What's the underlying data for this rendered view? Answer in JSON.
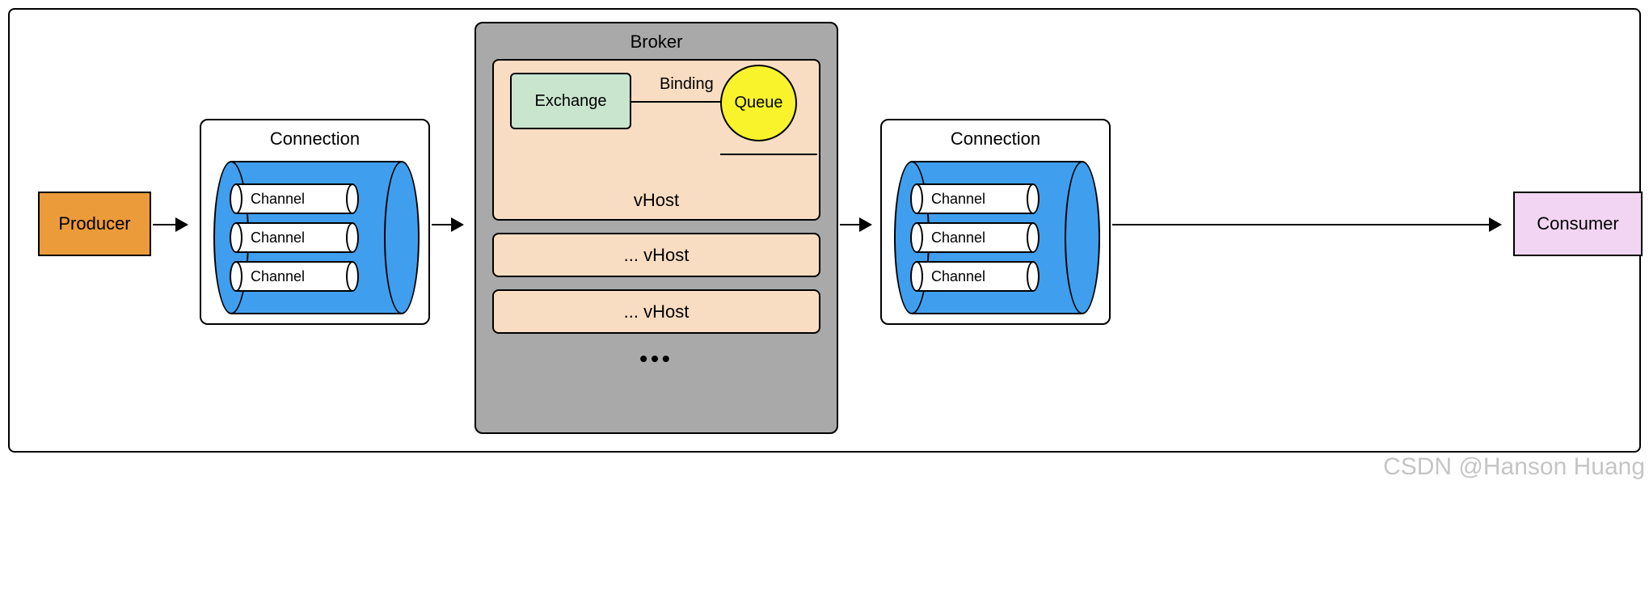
{
  "producer": {
    "label": "Producer"
  },
  "consumer": {
    "label": "Consumer"
  },
  "connection": {
    "title": "Connection",
    "channels": [
      "Channel",
      "Channel",
      "Channel"
    ]
  },
  "broker": {
    "title": "Broker",
    "vhost_main": {
      "exchange": "Exchange",
      "binding": "Binding",
      "queue": "Queue",
      "label": "vHost"
    },
    "vhost_rows": [
      "... vHost",
      "... vHost"
    ],
    "ellipsis": "•••"
  },
  "watermark": "CSDN @Hanson Huang",
  "colors": {
    "producer": "#ec9b3b",
    "consumer": "#f2d5f2",
    "cylinder": "#3f9fee",
    "broker_bg": "#a9a9a9",
    "vhost_bg": "#f9ddc3",
    "exchange": "#c9e5ce",
    "queue": "#f8f32b"
  }
}
